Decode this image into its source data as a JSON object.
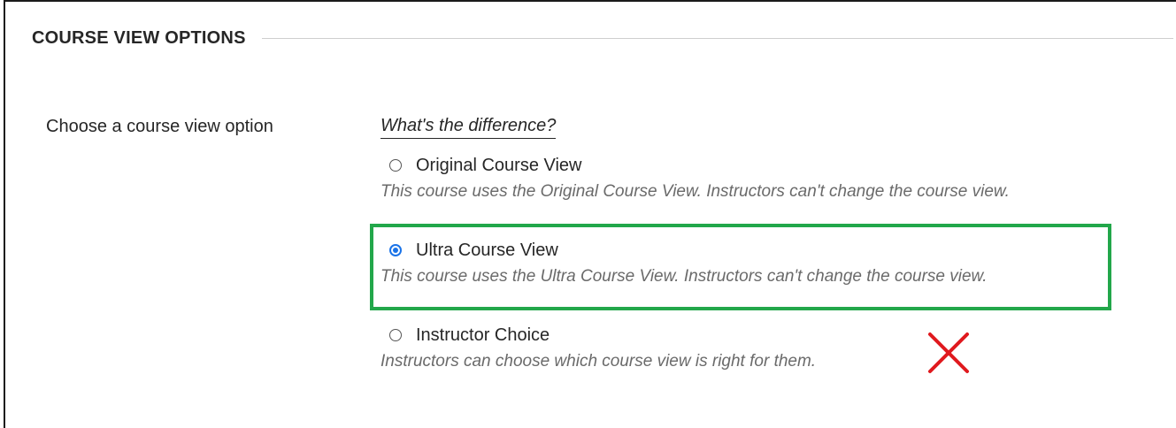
{
  "section": {
    "title": "COURSE VIEW OPTIONS"
  },
  "field": {
    "label": "Choose a course view option",
    "help_link": "What's the difference?"
  },
  "options": [
    {
      "label": "Original Course View",
      "description": "This course uses the Original Course View. Instructors can't change the course view.",
      "selected": false
    },
    {
      "label": "Ultra Course View",
      "description": "This course uses the Ultra Course View. Instructors can't change the course view.",
      "selected": true
    },
    {
      "label": "Instructor Choice",
      "description": "Instructors can choose which course view is right for them.",
      "selected": false
    }
  ],
  "annotations": {
    "highlight_color": "#22a74a",
    "cross_color": "#e0191e",
    "radio_selected_color": "#1a73e8"
  },
  "icons": {
    "cross": "red-x-mark-icon"
  }
}
